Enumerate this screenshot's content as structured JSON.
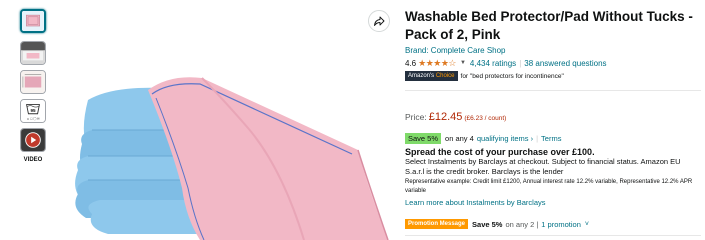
{
  "product": {
    "title": "Washable Bed Protector/Pad Without Tucks - Pack of 2, Pink",
    "brand": "Brand: Complete Care Shop",
    "rating_value": "4.6",
    "stars_glyph": "★★★★☆",
    "ratings_count": "4,434 ratings",
    "answered": "38 answered questions",
    "choice_prefix": "Amazon's",
    "choice_suffix": "Choice",
    "choice_for": "for \"bed protectors for incontinence\""
  },
  "price": {
    "label": "Price:",
    "amount": "£12.45",
    "per_unit": "(£6.23 / count)"
  },
  "savings": {
    "badge": "Save 5%",
    "on_any": "on any 4",
    "qualifying": "qualifying items ›",
    "terms": "Terms"
  },
  "instalments": {
    "heading": "Spread the cost of your purchase over £100.",
    "body": "Select Instalments by Barclays at checkout. Subject to financial status. Amazon EU S.a.r.l is the credit broker. Barclays is the lender",
    "example": "Representative example: Credit limit £1200, Annual interest rate 12.2% variable, Representative 12.2% APR variable",
    "learn_more": "Learn more about Instalments by Barclays"
  },
  "promotion": {
    "badge": "Promotion Message",
    "save": "Save 5%",
    "on_any": "on any 2 |",
    "link": "1 promotion",
    "caret": "˅"
  },
  "thumbnails": {
    "video_label": "VIDEO",
    "size_badge": "95"
  },
  "colors": {
    "link": "#007185",
    "price": "#b12704",
    "star": "#de7921",
    "save_badge": "#7fda69",
    "promo_badge": "#ff9900",
    "pad_pink": "#f2b8c6",
    "pad_blue": "#8ec8ec"
  },
  "icons": {
    "share": "share-arrow-icon",
    "play": "play-icon"
  }
}
